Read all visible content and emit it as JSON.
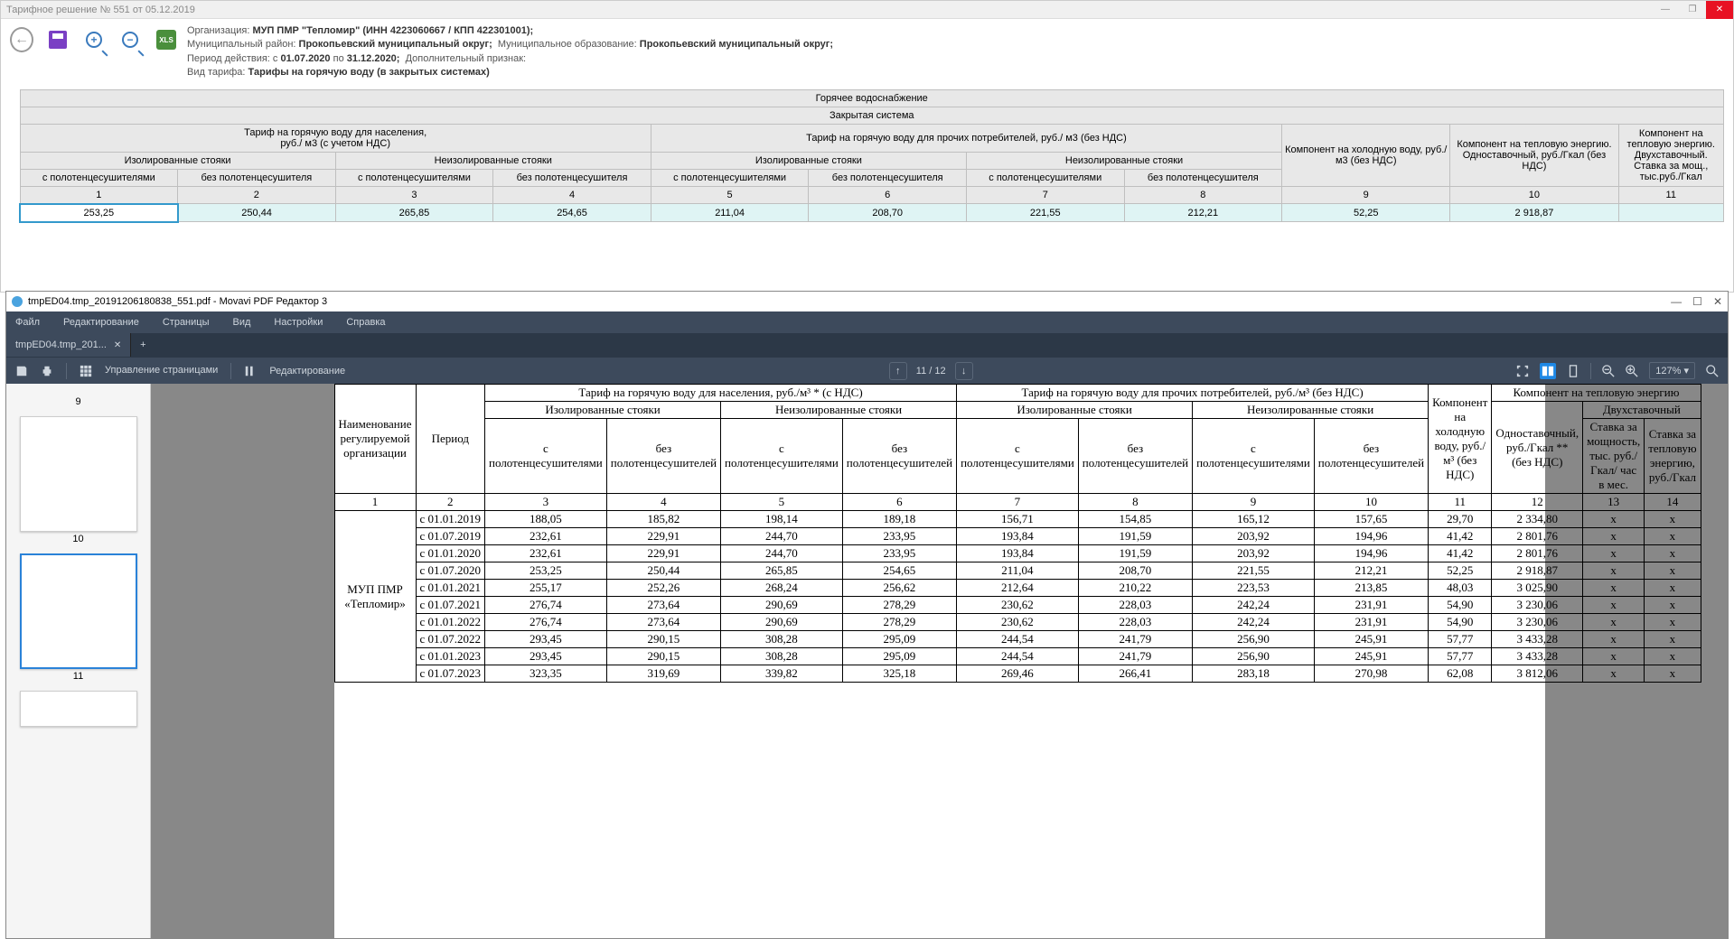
{
  "top_window": {
    "title": "Тарифное решение № 551 от 05.12.2019",
    "info": {
      "org_label": "Организация:",
      "org_value": "МУП ПМР \"Тепломир\" (ИНН 4223060667 / КПП 422301001);",
      "district_label": "Муниципальный район:",
      "district_value": "Прокопьевский муниципальный округ;",
      "mo_label": "Муниципальное образование:",
      "mo_value": "Прокопьевский муниципальный округ;",
      "period_label": "Период действия: с",
      "period_from": "01.07.2020",
      "period_to_label": "по",
      "period_to": "31.12.2020;",
      "addl_label": "Дополнительный признак:",
      "tariff_type_label": "Вид тарифа:",
      "tariff_type_value": "Тарифы на горячую воду (в закрытых системах)"
    },
    "table": {
      "r1": "Горячее водоснабжение",
      "r2": "Закрытая система",
      "h_pop": "Тариф на горячую воду для населения,\nруб./ м3 (с учетом НДС)",
      "h_other": "Тариф на горячую воду для прочих потребителей, руб./ м3 (без НДС)",
      "h_cold": "Компонент на холодную воду, руб./ м3 (без НДС)",
      "h_heat": "Компонент на тепловую энергию. Одноставочный, руб./Гкал (без НДС)",
      "h_heat2": "Компонент на тепловую энергию. Двухставочный. Ставка за мощ., тыс.руб./Гкал",
      "iso": "Изолированные стояки",
      "noniso": "Неизолированные стояки",
      "with_towel": "с полотенцесушителями",
      "without_towel": "без полотенцесушителя",
      "nums": [
        "1",
        "2",
        "3",
        "4",
        "5",
        "6",
        "7",
        "8",
        "9",
        "10",
        "11"
      ],
      "values": [
        "253,25",
        "250,44",
        "265,85",
        "254,65",
        "211,04",
        "208,70",
        "221,55",
        "212,21",
        "52,25",
        "2 918,87",
        ""
      ]
    }
  },
  "pdf_window": {
    "title": "tmpED04.tmp_20191206180838_551.pdf - Movavi PDF Редактор 3",
    "menus": [
      "Файл",
      "Редактирование",
      "Страницы",
      "Вид",
      "Настройки",
      "Справка"
    ],
    "tab_name": "tmpED04.tmp_201...",
    "toolbar": {
      "manage_pages": "Управление страницами",
      "editing": "Редактирование",
      "page_indicator": "11 / 12",
      "zoom": "127% ▾"
    },
    "thumbs": [
      "9",
      "10",
      "11"
    ],
    "doc": {
      "h_org": "Наименование регулируемой организации",
      "h_period": "Период",
      "h_pop": "Тариф на горячую воду для населения, руб./м³ * (с НДС)",
      "h_other": "Тариф на горячую воду для прочих потребителей, руб./м³ (без НДС)",
      "h_cold": "Компонент на холодную воду, руб./м³ (без НДС)",
      "h_heat": "Компонент на тепловую энергию",
      "h_single": "Одноставочный, руб./Гкал ** (без НДС)",
      "h_two": "Двухставочный",
      "h_cap": "Ставка за мощность, тыс. руб./ Гкал/ час в мес.",
      "h_en": "Ставка за тепловую энергию, руб./Гкал",
      "iso": "Изолированные стояки",
      "noniso": "Неизолированные стояки",
      "wt": "с полотенцесушителями",
      "wot": "без полотенцесушителей",
      "colnums": [
        "1",
        "2",
        "3",
        "4",
        "5",
        "6",
        "7",
        "8",
        "9",
        "10",
        "11",
        "12",
        "13",
        "14"
      ],
      "org": "МУП ПМР «Тепломир»",
      "rows": [
        [
          "с 01.01.2019",
          "188,05",
          "185,82",
          "198,14",
          "189,18",
          "156,71",
          "154,85",
          "165,12",
          "157,65",
          "29,70",
          "2 334,80",
          "x",
          "x"
        ],
        [
          "с 01.07.2019",
          "232,61",
          "229,91",
          "244,70",
          "233,95",
          "193,84",
          "191,59",
          "203,92",
          "194,96",
          "41,42",
          "2 801,76",
          "x",
          "x"
        ],
        [
          "с 01.01.2020",
          "232,61",
          "229,91",
          "244,70",
          "233,95",
          "193,84",
          "191,59",
          "203,92",
          "194,96",
          "41,42",
          "2 801,76",
          "x",
          "x"
        ],
        [
          "с 01.07.2020",
          "253,25",
          "250,44",
          "265,85",
          "254,65",
          "211,04",
          "208,70",
          "221,55",
          "212,21",
          "52,25",
          "2 918,87",
          "x",
          "x"
        ],
        [
          "с 01.01.2021",
          "255,17",
          "252,26",
          "268,24",
          "256,62",
          "212,64",
          "210,22",
          "223,53",
          "213,85",
          "48,03",
          "3 025,90",
          "x",
          "x"
        ],
        [
          "с 01.07.2021",
          "276,74",
          "273,64",
          "290,69",
          "278,29",
          "230,62",
          "228,03",
          "242,24",
          "231,91",
          "54,90",
          "3 230,06",
          "x",
          "x"
        ],
        [
          "с 01.01.2022",
          "276,74",
          "273,64",
          "290,69",
          "278,29",
          "230,62",
          "228,03",
          "242,24",
          "231,91",
          "54,90",
          "3 230,06",
          "x",
          "x"
        ],
        [
          "с 01.07.2022",
          "293,45",
          "290,15",
          "308,28",
          "295,09",
          "244,54",
          "241,79",
          "256,90",
          "245,91",
          "57,77",
          "3 433,28",
          "x",
          "x"
        ],
        [
          "с 01.01.2023",
          "293,45",
          "290,15",
          "308,28",
          "295,09",
          "244,54",
          "241,79",
          "256,90",
          "245,91",
          "57,77",
          "3 433,28",
          "x",
          "x"
        ],
        [
          "с 01.07.2023",
          "323,35",
          "319,69",
          "339,82",
          "325,18",
          "269,46",
          "266,41",
          "283,18",
          "270,98",
          "62,08",
          "3 812,06",
          "x",
          "x"
        ]
      ]
    }
  }
}
